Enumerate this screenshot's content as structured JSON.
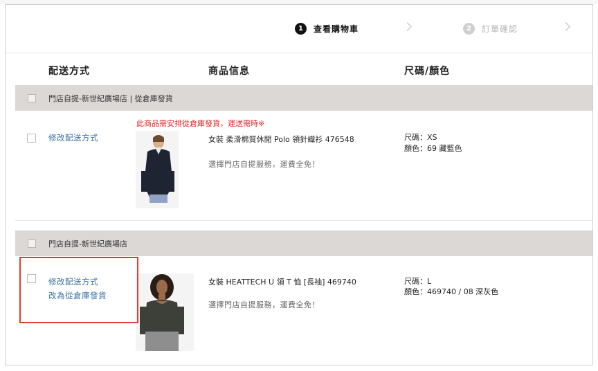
{
  "steps": [
    {
      "number": "1",
      "label": "查看購物車"
    },
    {
      "number": "2",
      "label": "訂單確認"
    }
  ],
  "columns": {
    "delivery": "配送方式",
    "product": "商品信息",
    "size_color": "尺碼/顏色"
  },
  "groups": [
    {
      "header": "門店自提-新世紀廣場店 | 從倉庫發貨",
      "warning": "此商品需安排從倉庫發貨，運送需時※",
      "links": [
        "修改配送方式"
      ],
      "product_name": "女裝 柔滑棉質休閒 Polo 領針織衫 476548",
      "note": "選擇門店自提服務，運費全免！",
      "size": "尺碼：XS",
      "color": "顏色：69 藏藍色"
    },
    {
      "header": "門店自提-新世紀廣場店",
      "links": [
        "修改配送方式",
        "改為從倉庫發貨"
      ],
      "product_name": "女裝 HEATTECH U 領 T 恤 [長袖] 469740",
      "note": "選擇門店自提服務，運費全免！",
      "size": "尺碼：L",
      "color": "顏色：469740 / 08 深灰色"
    }
  ],
  "colors": {
    "accent_link": "#3a6ea5",
    "warning": "#e02424",
    "group_header_bg": "#dcd8d6",
    "highlight_box": "#e53935"
  }
}
